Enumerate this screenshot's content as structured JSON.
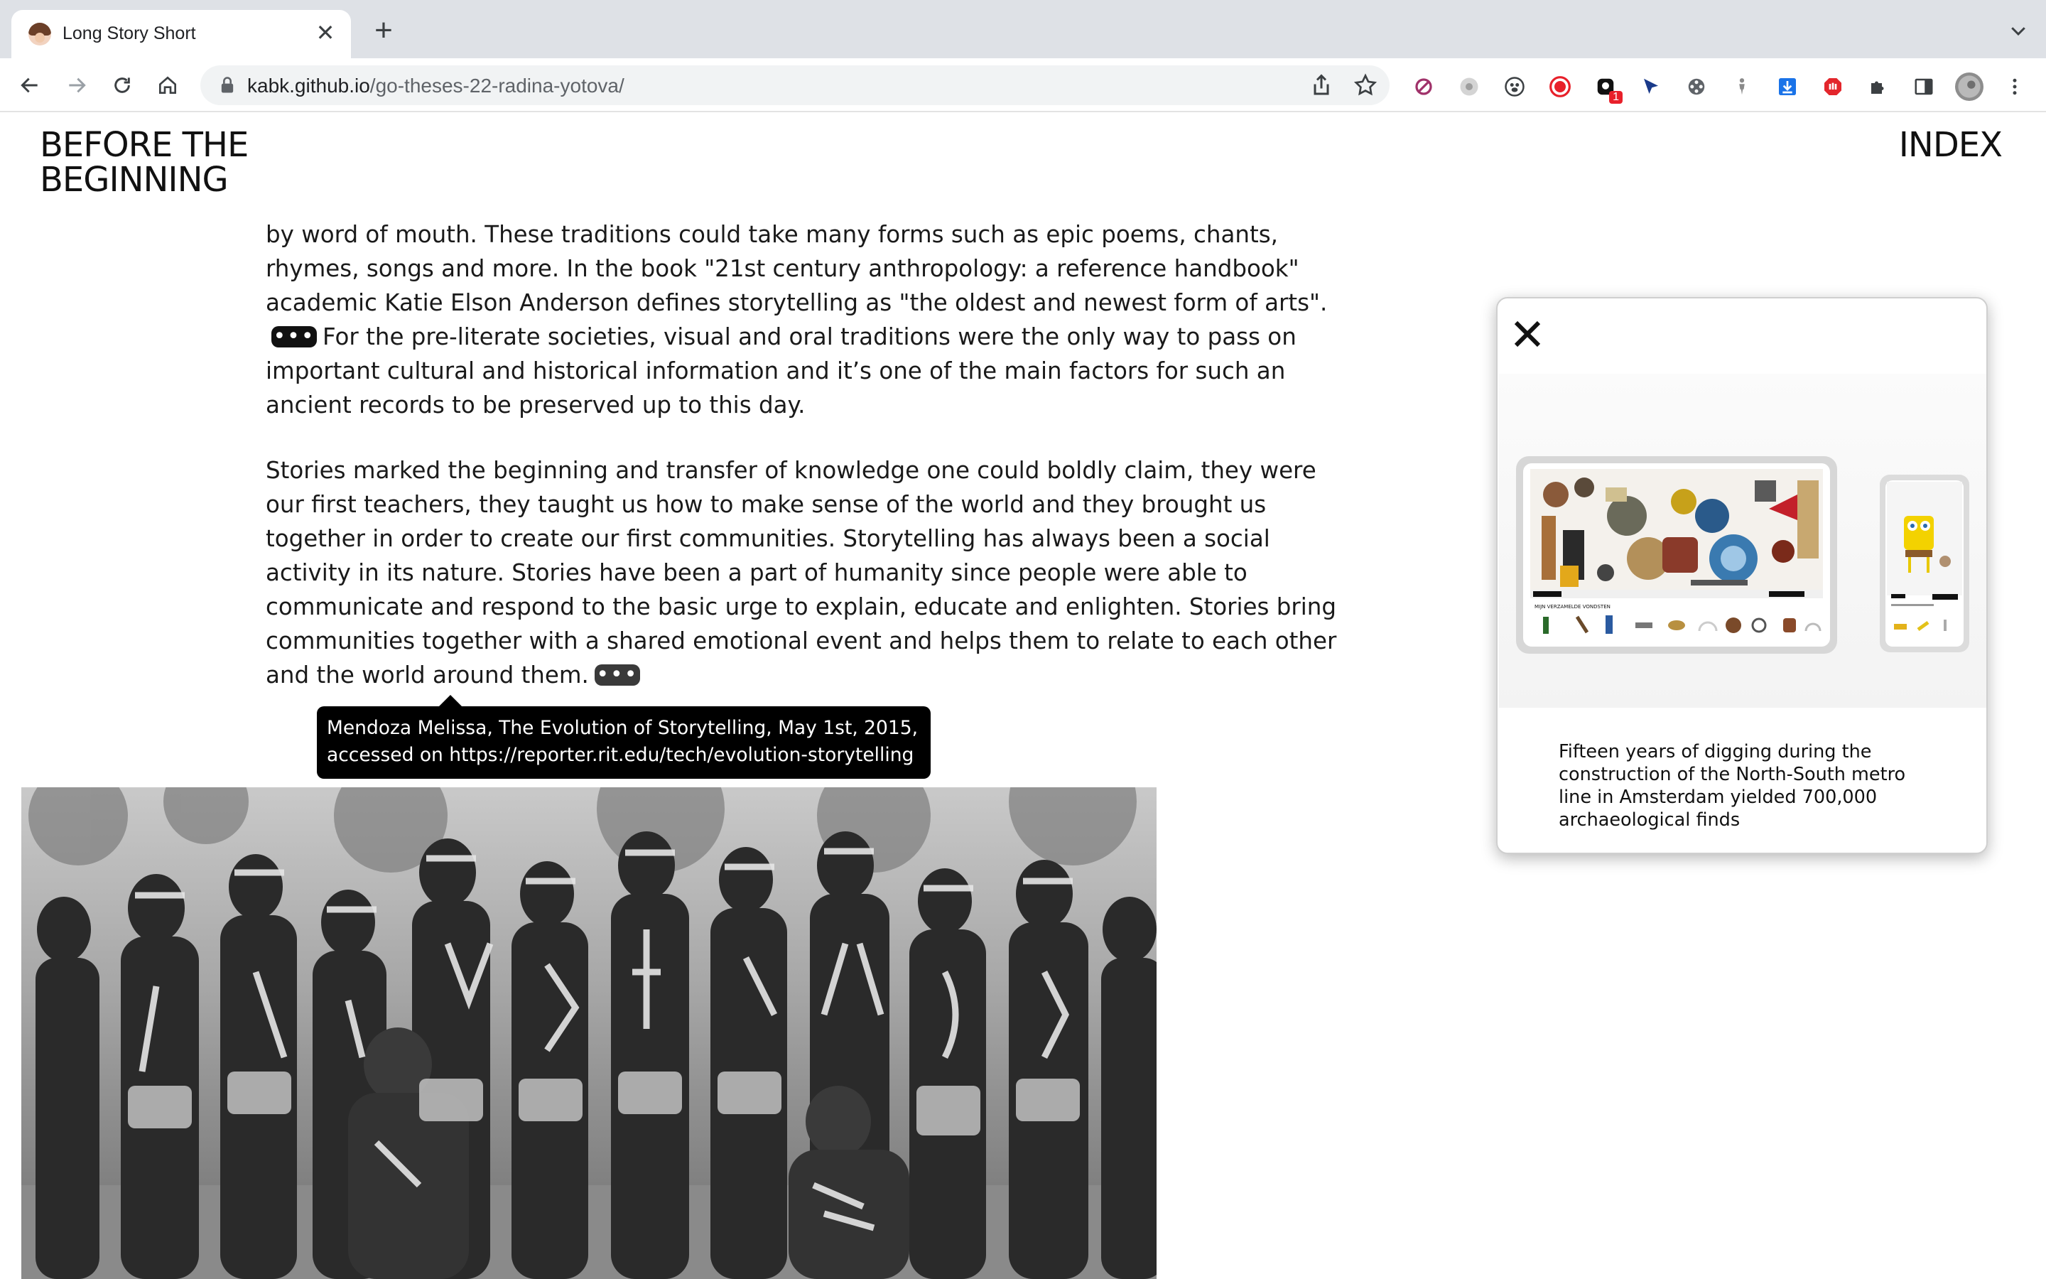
{
  "browser": {
    "tab": {
      "title": "Long Story Short",
      "close_glyph": "✕"
    },
    "new_tab_glyph": "+",
    "url": {
      "host": "kabk.github.io",
      "path": "/go-theses-22-radina-yotova/"
    },
    "extensions": [
      {
        "icon": "blocker-icon",
        "color": "#a0326a"
      },
      {
        "icon": "grey-circle-icon",
        "color": "#c6c6c6"
      },
      {
        "icon": "paw-icon",
        "color": "#3c4043"
      },
      {
        "icon": "record-icon",
        "color": "#e8202a"
      },
      {
        "icon": "notification-icon",
        "color": "#111111",
        "badge": "1"
      },
      {
        "icon": "cursor-icon",
        "color": "#1a3a8a"
      },
      {
        "icon": "film-icon",
        "color": "#3c4043"
      },
      {
        "icon": "person-icon",
        "color": "#8a8a8a"
      },
      {
        "icon": "download-icon",
        "color": "#1a73e8"
      },
      {
        "icon": "hand-icon",
        "color": "#e3262c"
      },
      {
        "icon": "puzzle-icon",
        "color": "#3c4043"
      },
      {
        "icon": "sidebar-icon",
        "color": "#3c4043"
      },
      {
        "icon": "profile-avatar-icon",
        "color": "#8d8d8d"
      },
      {
        "icon": "kebab-menu-icon",
        "color": "#3c4043"
      }
    ]
  },
  "site": {
    "title_line1": "BEFORE THE",
    "title_line2": "BEGINNING",
    "index_label": "INDEX"
  },
  "article": {
    "p1_a": "by word of mouth. These traditions could take many forms such as epic poems, chants, rhymes, songs and more. In the book \"21st century anthropology: a reference handbook\" academic Katie Elson Anderson defines storytelling as \"the oldest and newest form of arts\".",
    "p1_b": "For the pre-literate societies, visual and oral traditions were the only way to pass on important cultural and historical information and it’s one of the main factors for such an ancient records to be preserved up to this day.",
    "p2": "Stories marked the beginning and transfer of knowledge one could boldly claim, they were our first teachers, they taught us how to make sense of the world and they brought us together in order to create our first communities. Storytelling has always been a social activity in its nature. Stories have been a part of humanity since people were able to communicate and respond to the basic urge to explain, educate and enlighten. Stories bring communities together with a shared emotional event and helps them to relate to each other and the world around them."
  },
  "tooltip": {
    "line1": "Mendoza Melissa, The Evolution of Storytelling, May 1st, 2015,",
    "line2": "accessed on https://reporter.rit.edu/tech/evolution-storytelling"
  },
  "modal": {
    "close_glyph": "✕",
    "caption": "Fifteen years of digging during the construction of the North-South metro line in Amsterdam yielded 700,000 archaeological finds",
    "screenshot_label": "MIJN VERZAMELDE VONDSTEN"
  }
}
